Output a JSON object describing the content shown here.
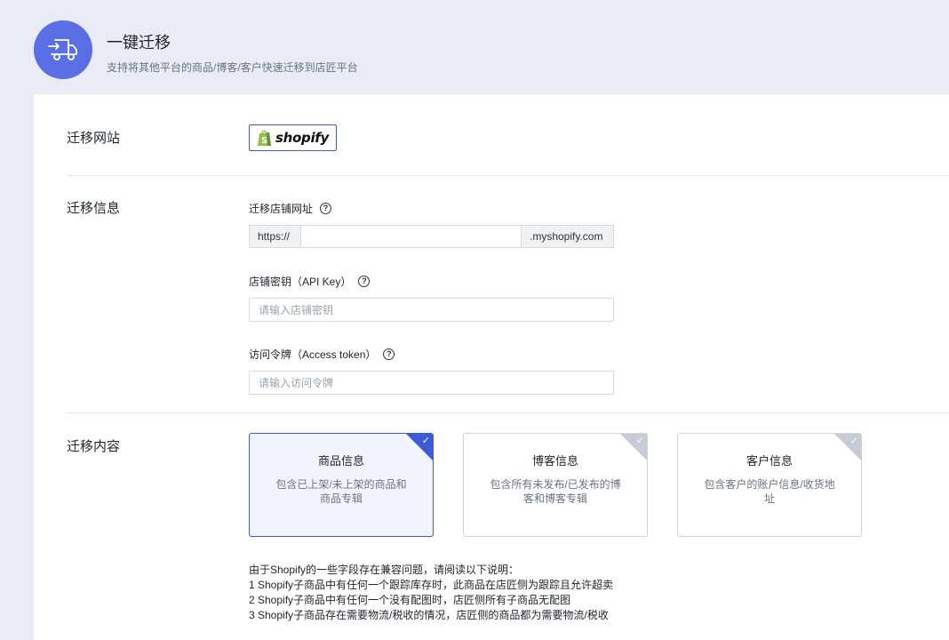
{
  "header": {
    "icon": "truck-icon",
    "title": "一键迁移",
    "subtitle": "支持将其他平台的商品/博客/客户快速迁移到店匠平台"
  },
  "sections": {
    "site_label": "迁移网站",
    "info_label": "迁移信息",
    "content_label": "迁移内容"
  },
  "platform": {
    "name": "shopify",
    "icon": "shopify-bag-icon"
  },
  "fields": {
    "url": {
      "label": "迁移店铺网址",
      "prefix": "https://",
      "suffix": ".myshopify.com",
      "value": ""
    },
    "api_key": {
      "label": "店铺密钥（API Key）",
      "placeholder": "请输入店铺密钥"
    },
    "token": {
      "label": "访问令牌（Access token）",
      "placeholder": "请输入访问令牌"
    }
  },
  "options": [
    {
      "title": "商品信息",
      "desc": "包含已上架/未上架的商品和商品专辑",
      "selected": true
    },
    {
      "title": "博客信息",
      "desc": "包含所有未发布/已发布的博客和博客专辑",
      "selected": false
    },
    {
      "title": "客户信息",
      "desc": "包含客户的账户信息/收货地址",
      "selected": false
    }
  ],
  "notes": [
    "由于Shopify的一些字段存在兼容问题，请阅读以下说明：",
    "1 Shopify子商品中有任何一个跟踪库存时，此商品在店匠侧为跟踪且允许超卖",
    "2 Shopify子商品中有任何一个没有配图时，店匠侧所有子商品无配图",
    "3 Shopify子商品存在需要物流/税收的情况，店匠侧的商品都为需要物流/税收"
  ],
  "colors": {
    "accent": "#3d5bd6",
    "header_icon_bg": "#5a6ee6",
    "shopify_green": "#95bf47"
  }
}
